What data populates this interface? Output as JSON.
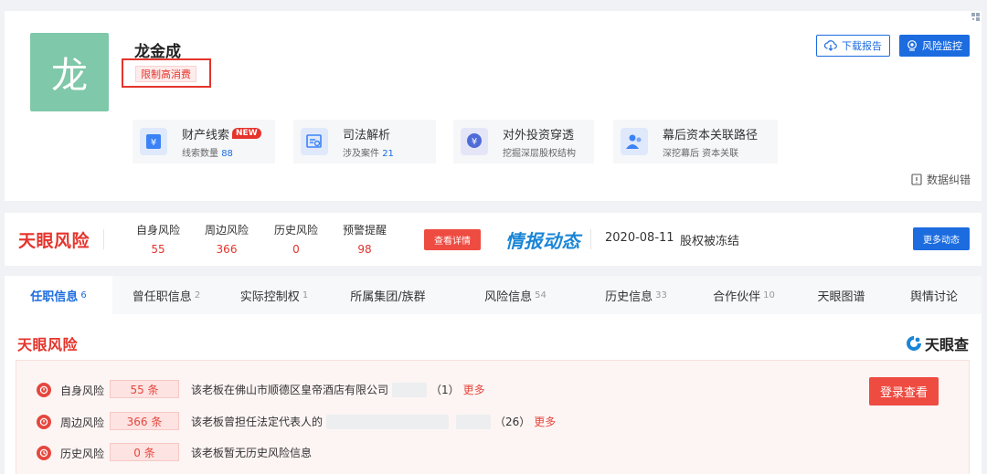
{
  "profile": {
    "avatar_char": "龙",
    "name": "龙金成",
    "tag": "限制高消费",
    "download_label": "下载报告",
    "monitor_label": "风险监控",
    "features": [
      {
        "title": "财产线索",
        "badge": "NEW",
        "sub_label": "线索数量",
        "sub_value": "88"
      },
      {
        "title": "司法解析",
        "sub_label": "涉及案件",
        "sub_value": "21"
      },
      {
        "title": "对外投资穿透",
        "sub_label": "挖掘深层股权结构"
      },
      {
        "title": "幕后资本关联路径",
        "sub_label": "深挖幕后 资本关联"
      }
    ],
    "correction_label": "数据纠错"
  },
  "riskbar": {
    "brand": "天眼风险",
    "stats": [
      {
        "label": "自身风险",
        "value": "55"
      },
      {
        "label": "周边风险",
        "value": "366"
      },
      {
        "label": "历史风险",
        "value": "0"
      },
      {
        "label": "预警提醒",
        "value": "98"
      }
    ],
    "detail_label": "查看详情",
    "intel_title": "情报动态",
    "intel_date": "2020-08-11",
    "intel_text": "股权被冻结",
    "more_label": "更多动态"
  },
  "tabs": [
    {
      "label": "任职信息",
      "count": "6"
    },
    {
      "label": "曾任职信息",
      "count": "2"
    },
    {
      "label": "实际控制权",
      "count": "1"
    },
    {
      "label": "所属集团/族群",
      "count": ""
    },
    {
      "label": "风险信息",
      "count": "54"
    },
    {
      "label": "历史信息",
      "count": "33"
    },
    {
      "label": "合作伙伴",
      "count": "10"
    },
    {
      "label": "天眼图谱",
      "count": ""
    },
    {
      "label": "舆情讨论",
      "count": ""
    }
  ],
  "content": {
    "brand": "天眼风险",
    "logo_text": "天眼查",
    "rows": [
      {
        "label": "自身风险",
        "count": "55 条",
        "desc": "该老板在佛山市顺德区皇帝酒店有限公司",
        "suffix": "（1）",
        "more": "更多"
      },
      {
        "label": "周边风险",
        "count": "366 条",
        "desc": "该老板曾担任法定代表人的",
        "suffix": "（26）",
        "more": "更多"
      },
      {
        "label": "历史风险",
        "count": "0 条",
        "desc": "该老板暂无历史风险信息"
      }
    ],
    "login_label": "登录查看"
  }
}
